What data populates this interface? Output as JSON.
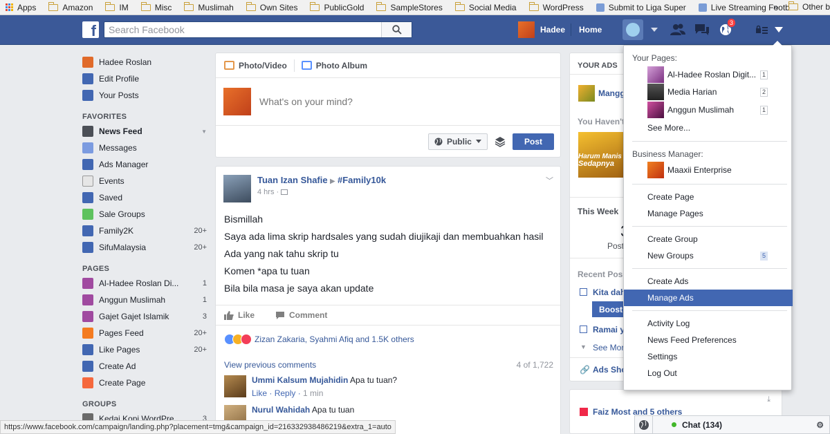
{
  "bookmarks": [
    {
      "label": "Apps",
      "icon": "apps-grid-icon"
    },
    {
      "label": "Amazon",
      "icon": "folder-icon"
    },
    {
      "label": "IM",
      "icon": "folder-icon"
    },
    {
      "label": "Misc",
      "icon": "folder-icon"
    },
    {
      "label": "Muslimah",
      "icon": "folder-icon"
    },
    {
      "label": "Own Sites",
      "icon": "folder-icon"
    },
    {
      "label": "PublicGold",
      "icon": "folder-icon"
    },
    {
      "label": "SampleStores",
      "icon": "folder-icon"
    },
    {
      "label": "Social Media",
      "icon": "folder-icon"
    },
    {
      "label": "WordPress",
      "icon": "folder-icon"
    },
    {
      "label": "Submit to Liga Super",
      "icon": "page-icon"
    },
    {
      "label": "Live Streaming Footb",
      "icon": "page-icon"
    }
  ],
  "bookmarks_more": "»",
  "bookmarks_other": "Other b",
  "topbar": {
    "search_placeholder": "Search Facebook",
    "user_name": "Hadee",
    "home_label": "Home",
    "notification_count": "3"
  },
  "left_nav": {
    "profile": [
      {
        "label": "Hadee Roslan",
        "icon": "avatar-icon"
      },
      {
        "label": "Edit Profile",
        "icon": "pencil-icon"
      },
      {
        "label": "Your Posts",
        "icon": "person-icon"
      }
    ],
    "favorites_title": "FAVORITES",
    "favorites": [
      {
        "label": "News Feed",
        "icon": "newsfeed-icon",
        "count": ""
      },
      {
        "label": "Messages",
        "icon": "messages-icon",
        "count": ""
      },
      {
        "label": "Ads Manager",
        "icon": "ads-manager-icon",
        "count": ""
      },
      {
        "label": "Events",
        "icon": "calendar-icon",
        "count": ""
      },
      {
        "label": "Saved",
        "icon": "bookmark-icon",
        "count": ""
      },
      {
        "label": "Sale Groups",
        "icon": "sale-groups-icon",
        "count": ""
      },
      {
        "label": "Family2K",
        "icon": "group-icon",
        "count": "20+"
      },
      {
        "label": "SifuMalaysia",
        "icon": "group-icon",
        "count": "20+"
      }
    ],
    "pages_title": "PAGES",
    "pages": [
      {
        "label": "Al-Hadee Roslan Di...",
        "icon": "page-avatar-icon",
        "count": "1"
      },
      {
        "label": "Anggun Muslimah",
        "icon": "page-avatar-icon",
        "count": "1"
      },
      {
        "label": "Gajet Gajet Islamik",
        "icon": "page-avatar-icon",
        "count": "3"
      },
      {
        "label": "Pages Feed",
        "icon": "flag-icon",
        "count": "20+"
      },
      {
        "label": "Like Pages",
        "icon": "thumbs-up-icon",
        "count": "20+"
      },
      {
        "label": "Create Ad",
        "icon": "ads-manager-icon",
        "count": ""
      },
      {
        "label": "Create Page",
        "icon": "plus-icon",
        "count": ""
      }
    ],
    "groups_title": "GROUPS",
    "groups": [
      {
        "label": "Kedai Kopi WordPre...",
        "icon": "book-icon",
        "count": "3"
      }
    ]
  },
  "composer": {
    "tab_photo": "Photo/Video",
    "tab_album": "Photo Album",
    "placeholder": "What's on your mind?",
    "privacy_label": "Public",
    "post_label": "Post"
  },
  "post": {
    "author": "Tuan Izan Shafie",
    "tag": "#Family10k",
    "time": "4 hrs",
    "lines": [
      "Bismillah",
      "Saya ada lima skrip hardsales yang sudah diujikaji dan membuahkan hasil",
      "Ada yang nak tahu skrip tu",
      "Komen *apa tu tuan",
      "Bila bila masa je saya akan update"
    ],
    "like_label": "Like",
    "comment_label": "Comment",
    "reactions_text": "Zizan Zakaria, Syahmi Afiq and 1.5K others",
    "view_previous": "View previous comments",
    "comment_count": "4 of 1,722",
    "comments": [
      {
        "name": "Ummi Kalsum Mujahidin",
        "text": "Apa tu tuan?",
        "like": "Like",
        "reply": "Reply",
        "time": "1 min"
      },
      {
        "name": "Nurul Wahidah",
        "text": "Apa tu tuan"
      }
    ]
  },
  "right_col": {
    "your_ads": "YOUR ADS",
    "ad_name": "Mangg",
    "you_havent": "You Haven't",
    "ad_image_text_1": "Harum Manis",
    "ad_image_text_2": "Sedapnya",
    "this_week": "This Week",
    "week_number": "3",
    "posts_label": "Post",
    "recent_posts": "Recent Pos",
    "recent_1": "Kita dah",
    "boost": "Boost",
    "recent_2": "Ramai y",
    "see_more": "See Mor",
    "ads_shortcut": "Ads Sho",
    "faiz": "Faiz Most and 5 others"
  },
  "dropdown": {
    "your_pages_title": "Your Pages:",
    "pages": [
      {
        "label": "Al-Hadee Roslan Digit...",
        "count": "1"
      },
      {
        "label": "Media Harian",
        "count": "2"
      },
      {
        "label": "Anggun Muslimah",
        "count": "1"
      }
    ],
    "see_more": "See More...",
    "business_manager_title": "Business Manager:",
    "business": "Maaxii Enterprise",
    "create_page": "Create Page",
    "manage_pages": "Manage Pages",
    "create_group": "Create Group",
    "new_groups": "New Groups",
    "new_groups_count": "5",
    "create_ads": "Create Ads",
    "manage_ads": "Manage Ads",
    "activity_log": "Activity Log",
    "news_feed_prefs": "News Feed Preferences",
    "settings": "Settings",
    "log_out": "Log Out"
  },
  "status_url": "https://www.facebook.com/campaign/landing.php?placement=tmg&campaign_id=216332938486219&extra_1=auto",
  "chat": {
    "label": "Chat (134)"
  },
  "colors": {
    "brand": "#3b5998",
    "accent": "#4267b2",
    "link": "#365899",
    "badge": "#fa3e3e"
  }
}
